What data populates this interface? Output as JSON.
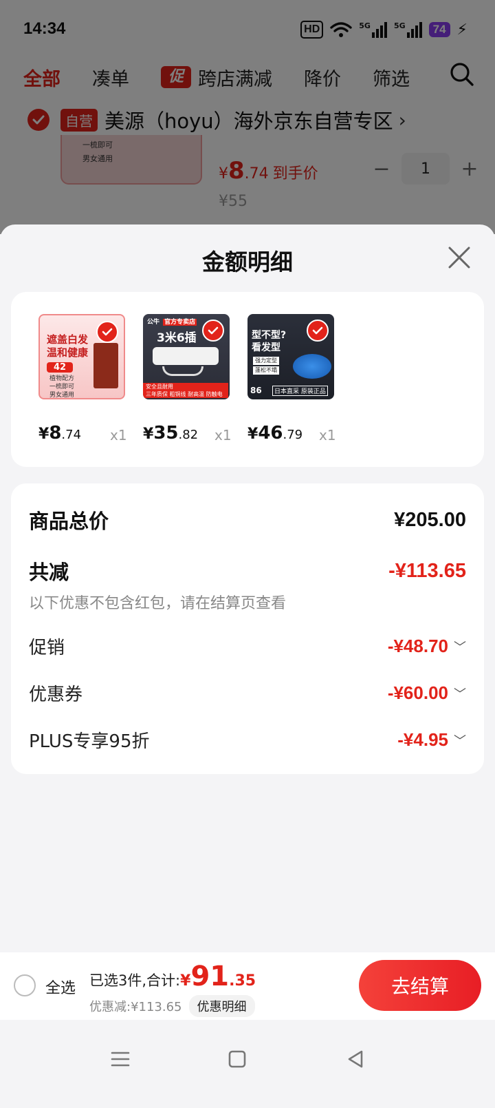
{
  "status_bar": {
    "time": "14:34",
    "hd_label": "HD",
    "network1": "5G",
    "network2": "5G",
    "battery": "74"
  },
  "tabs": [
    {
      "label": "全部"
    },
    {
      "label": "凑单"
    },
    {
      "label": "跨店满减",
      "badge": "促"
    },
    {
      "label": "降价"
    },
    {
      "label": "筛选"
    }
  ],
  "store": {
    "tag": "自营",
    "name": "美源（hoyu）海外京东自营专区",
    "arrow": "›"
  },
  "bg_item": {
    "price_currency": "¥",
    "price_int": "8",
    "price_dec": ".74",
    "price_suffix": "到手价",
    "original_price": "¥55",
    "quantity": "1",
    "minus": "−",
    "plus": "+",
    "thumb_notes": [
      "一梳即可",
      "男女通用"
    ]
  },
  "sheet": {
    "title": "金额明细",
    "items": [
      {
        "currency": "¥",
        "price_int": "8",
        "price_dec": ".74",
        "qty": "x1",
        "thumb_lines": [
          "遮盖白发",
          "温和健康",
          "42",
          "植物配方",
          "一梳即可",
          "男女通用"
        ]
      },
      {
        "currency": "¥",
        "price_int": "35",
        "price_dec": ".82",
        "qty": "x1",
        "thumb_lines": [
          "公牛",
          "官方专卖店",
          "3米6插",
          "安全且耐用",
          "三年质保",
          "粗铜线 耐高温 防触电"
        ]
      },
      {
        "currency": "¥",
        "price_int": "46",
        "price_dec": ".79",
        "qty": "x1",
        "thumb_lines": [
          "型不型?",
          "看发型",
          "强力定型",
          "蓬松不塌",
          "86",
          "日本直采",
          "原装正品"
        ]
      }
    ],
    "summary": {
      "total_label": "商品总价",
      "total_value": "¥205.00",
      "reduce_label": "共减",
      "reduce_value": "-¥113.65",
      "note": "以下优惠不包含红包，请在结算页查看",
      "lines": [
        {
          "label": "促销",
          "value": "-¥48.70"
        },
        {
          "label": "优惠券",
          "value": "-¥60.00"
        },
        {
          "label": "PLUS专享95折",
          "value": "-¥4.95"
        }
      ]
    }
  },
  "checkout": {
    "select_all": "全选",
    "selected_text": "已选3件,合计:",
    "currency": "¥",
    "total_int": "91",
    "total_dec": ".35",
    "discount_text": "优惠减:¥113.65",
    "discount_detail_btn": "优惠明细",
    "checkout_btn": "去结算"
  },
  "colors": {
    "accent": "#e2231a",
    "background": "#f4f4f6"
  },
  "icons": [
    "search-icon",
    "close-icon",
    "check-icon",
    "menu-icon",
    "home-icon",
    "back-icon"
  ]
}
